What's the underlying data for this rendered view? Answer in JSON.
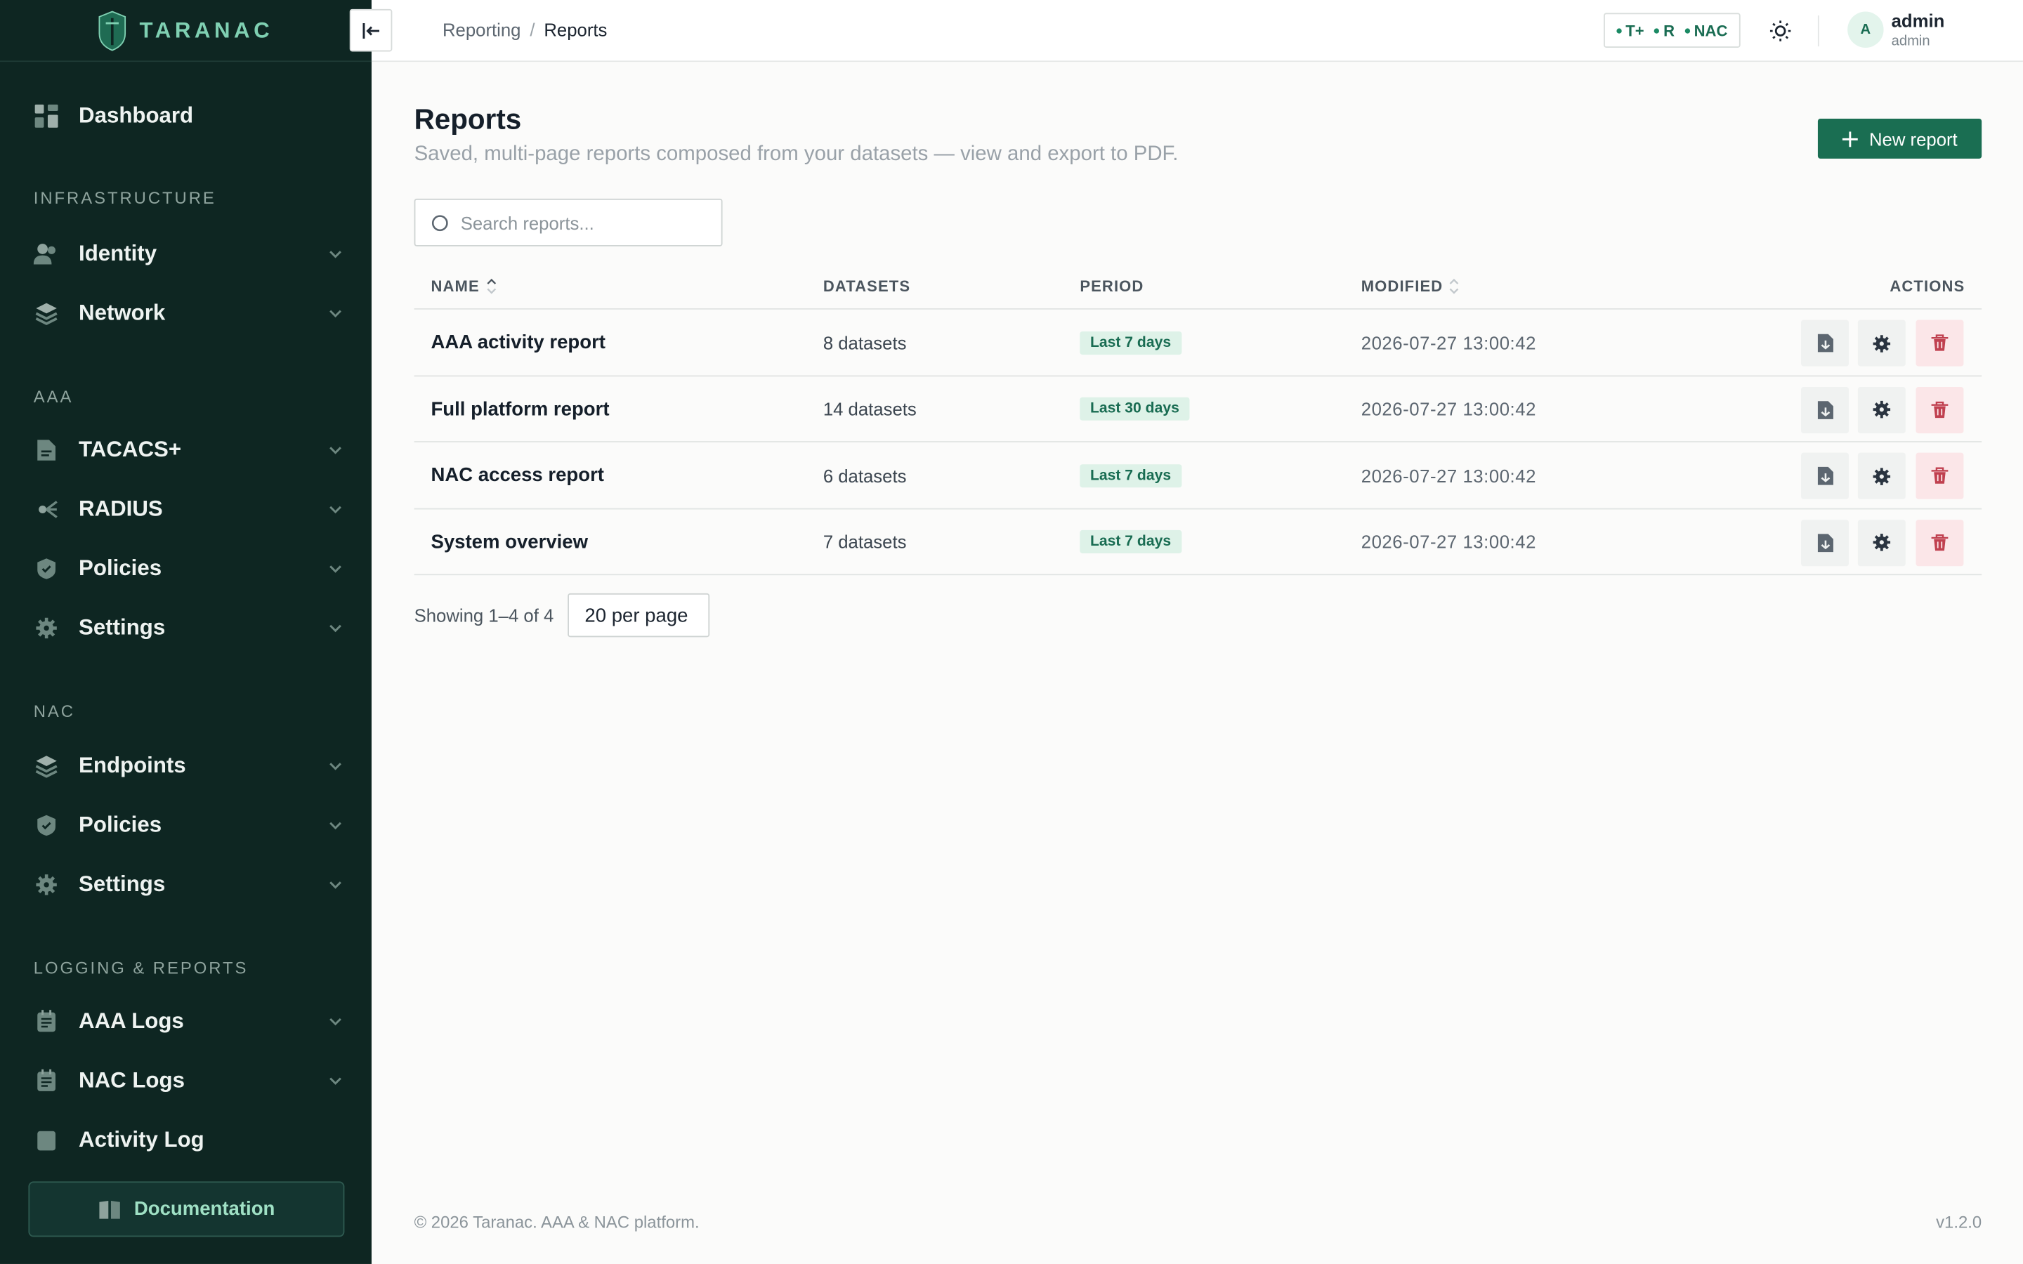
{
  "brand": {
    "name": "TARANAC"
  },
  "sidebar": {
    "dashboard": "Dashboard",
    "sections": {
      "infrastructure": "INFRASTRUCTURE",
      "aaa": "AAA",
      "nac": "NAC",
      "logging": "LOGGING & REPORTS"
    },
    "items": [
      {
        "label": "Identity",
        "icon": "users-icon"
      },
      {
        "label": "Network",
        "icon": "layers-icon"
      },
      {
        "label": "TACACS+",
        "icon": "file-icon"
      },
      {
        "label": "RADIUS",
        "icon": "radius-icon"
      },
      {
        "label": "Policies",
        "icon": "shield-check-icon"
      },
      {
        "label": "Settings",
        "icon": "gear-icon"
      },
      {
        "label": "Endpoints",
        "icon": "layers-icon"
      },
      {
        "label": "Policies",
        "icon": "shield-check-icon"
      },
      {
        "label": "Settings",
        "icon": "gear-icon"
      },
      {
        "label": "AAA Logs",
        "icon": "log-icon"
      },
      {
        "label": "NAC Logs",
        "icon": "log-icon"
      },
      {
        "label": "Activity Log",
        "icon": "activity-icon"
      }
    ],
    "documentation": "Documentation"
  },
  "topbar": {
    "breadcrumb": {
      "parent": "Reporting",
      "separator": "/",
      "current": "Reports"
    },
    "status": {
      "t": "T+",
      "r": "R",
      "nac": "NAC"
    },
    "user": {
      "initial": "A",
      "name": "admin",
      "role": "admin"
    }
  },
  "page": {
    "title": "Reports",
    "subtitle": "Saved, multi-page reports composed from your datasets — view and export to PDF.",
    "new_button": "New report",
    "search_placeholder": "Search reports..."
  },
  "table": {
    "headers": {
      "name": "NAME",
      "datasets": "DATASETS",
      "period": "PERIOD",
      "modified": "MODIFIED",
      "actions": "ACTIONS"
    },
    "rows": [
      {
        "name": "AAA activity report",
        "datasets": "8 datasets",
        "period": "Last 7 days",
        "modified": "2026-07-27 13:00:42"
      },
      {
        "name": "Full platform report",
        "datasets": "14 datasets",
        "period": "Last 30 days",
        "modified": "2026-07-27 13:00:42"
      },
      {
        "name": "NAC access report",
        "datasets": "6 datasets",
        "period": "Last 7 days",
        "modified": "2026-07-27 13:00:42"
      },
      {
        "name": "System overview",
        "datasets": "7 datasets",
        "period": "Last 7 days",
        "modified": "2026-07-27 13:00:42"
      }
    ]
  },
  "pager": {
    "info": "Showing 1–4 of 4",
    "per_page": "20 per page"
  },
  "footer": {
    "copyright": "© 2026 Taranac. AAA & NAC platform.",
    "version": "v1.2.0"
  },
  "colors": {
    "sidebar": "#0e2622",
    "accent": "#1a6e52",
    "badge_bg": "#def2e8",
    "danger_bg": "#fbe6e8"
  }
}
